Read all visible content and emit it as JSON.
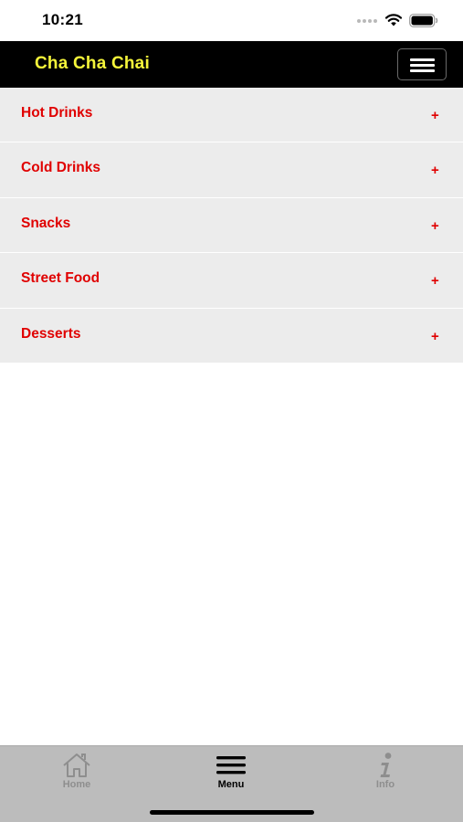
{
  "status_bar": {
    "time": "10:21"
  },
  "header": {
    "title": "Cha Cha Chai",
    "title_color": "#f5f53a",
    "menu_icon": "hamburger-icon"
  },
  "categories": [
    {
      "label": "Hot Drinks",
      "expand_symbol": "+"
    },
    {
      "label": "Cold Drinks",
      "expand_symbol": "+"
    },
    {
      "label": "Snacks",
      "expand_symbol": "+"
    },
    {
      "label": "Street Food",
      "expand_symbol": "+"
    },
    {
      "label": "Desserts",
      "expand_symbol": "+"
    }
  ],
  "tab_bar": {
    "active_tab": "Menu",
    "tabs": [
      {
        "label": "Home",
        "icon": "home-icon"
      },
      {
        "label": "Menu",
        "icon": "menu-icon"
      },
      {
        "label": "Info",
        "icon": "info-icon"
      }
    ]
  },
  "colors": {
    "accent_red": "#e00000",
    "row_background": "#ececec",
    "nav_background": "#000000",
    "tab_bar_background": "#bcbcbc",
    "inactive_tab": "#8e8e8e"
  }
}
